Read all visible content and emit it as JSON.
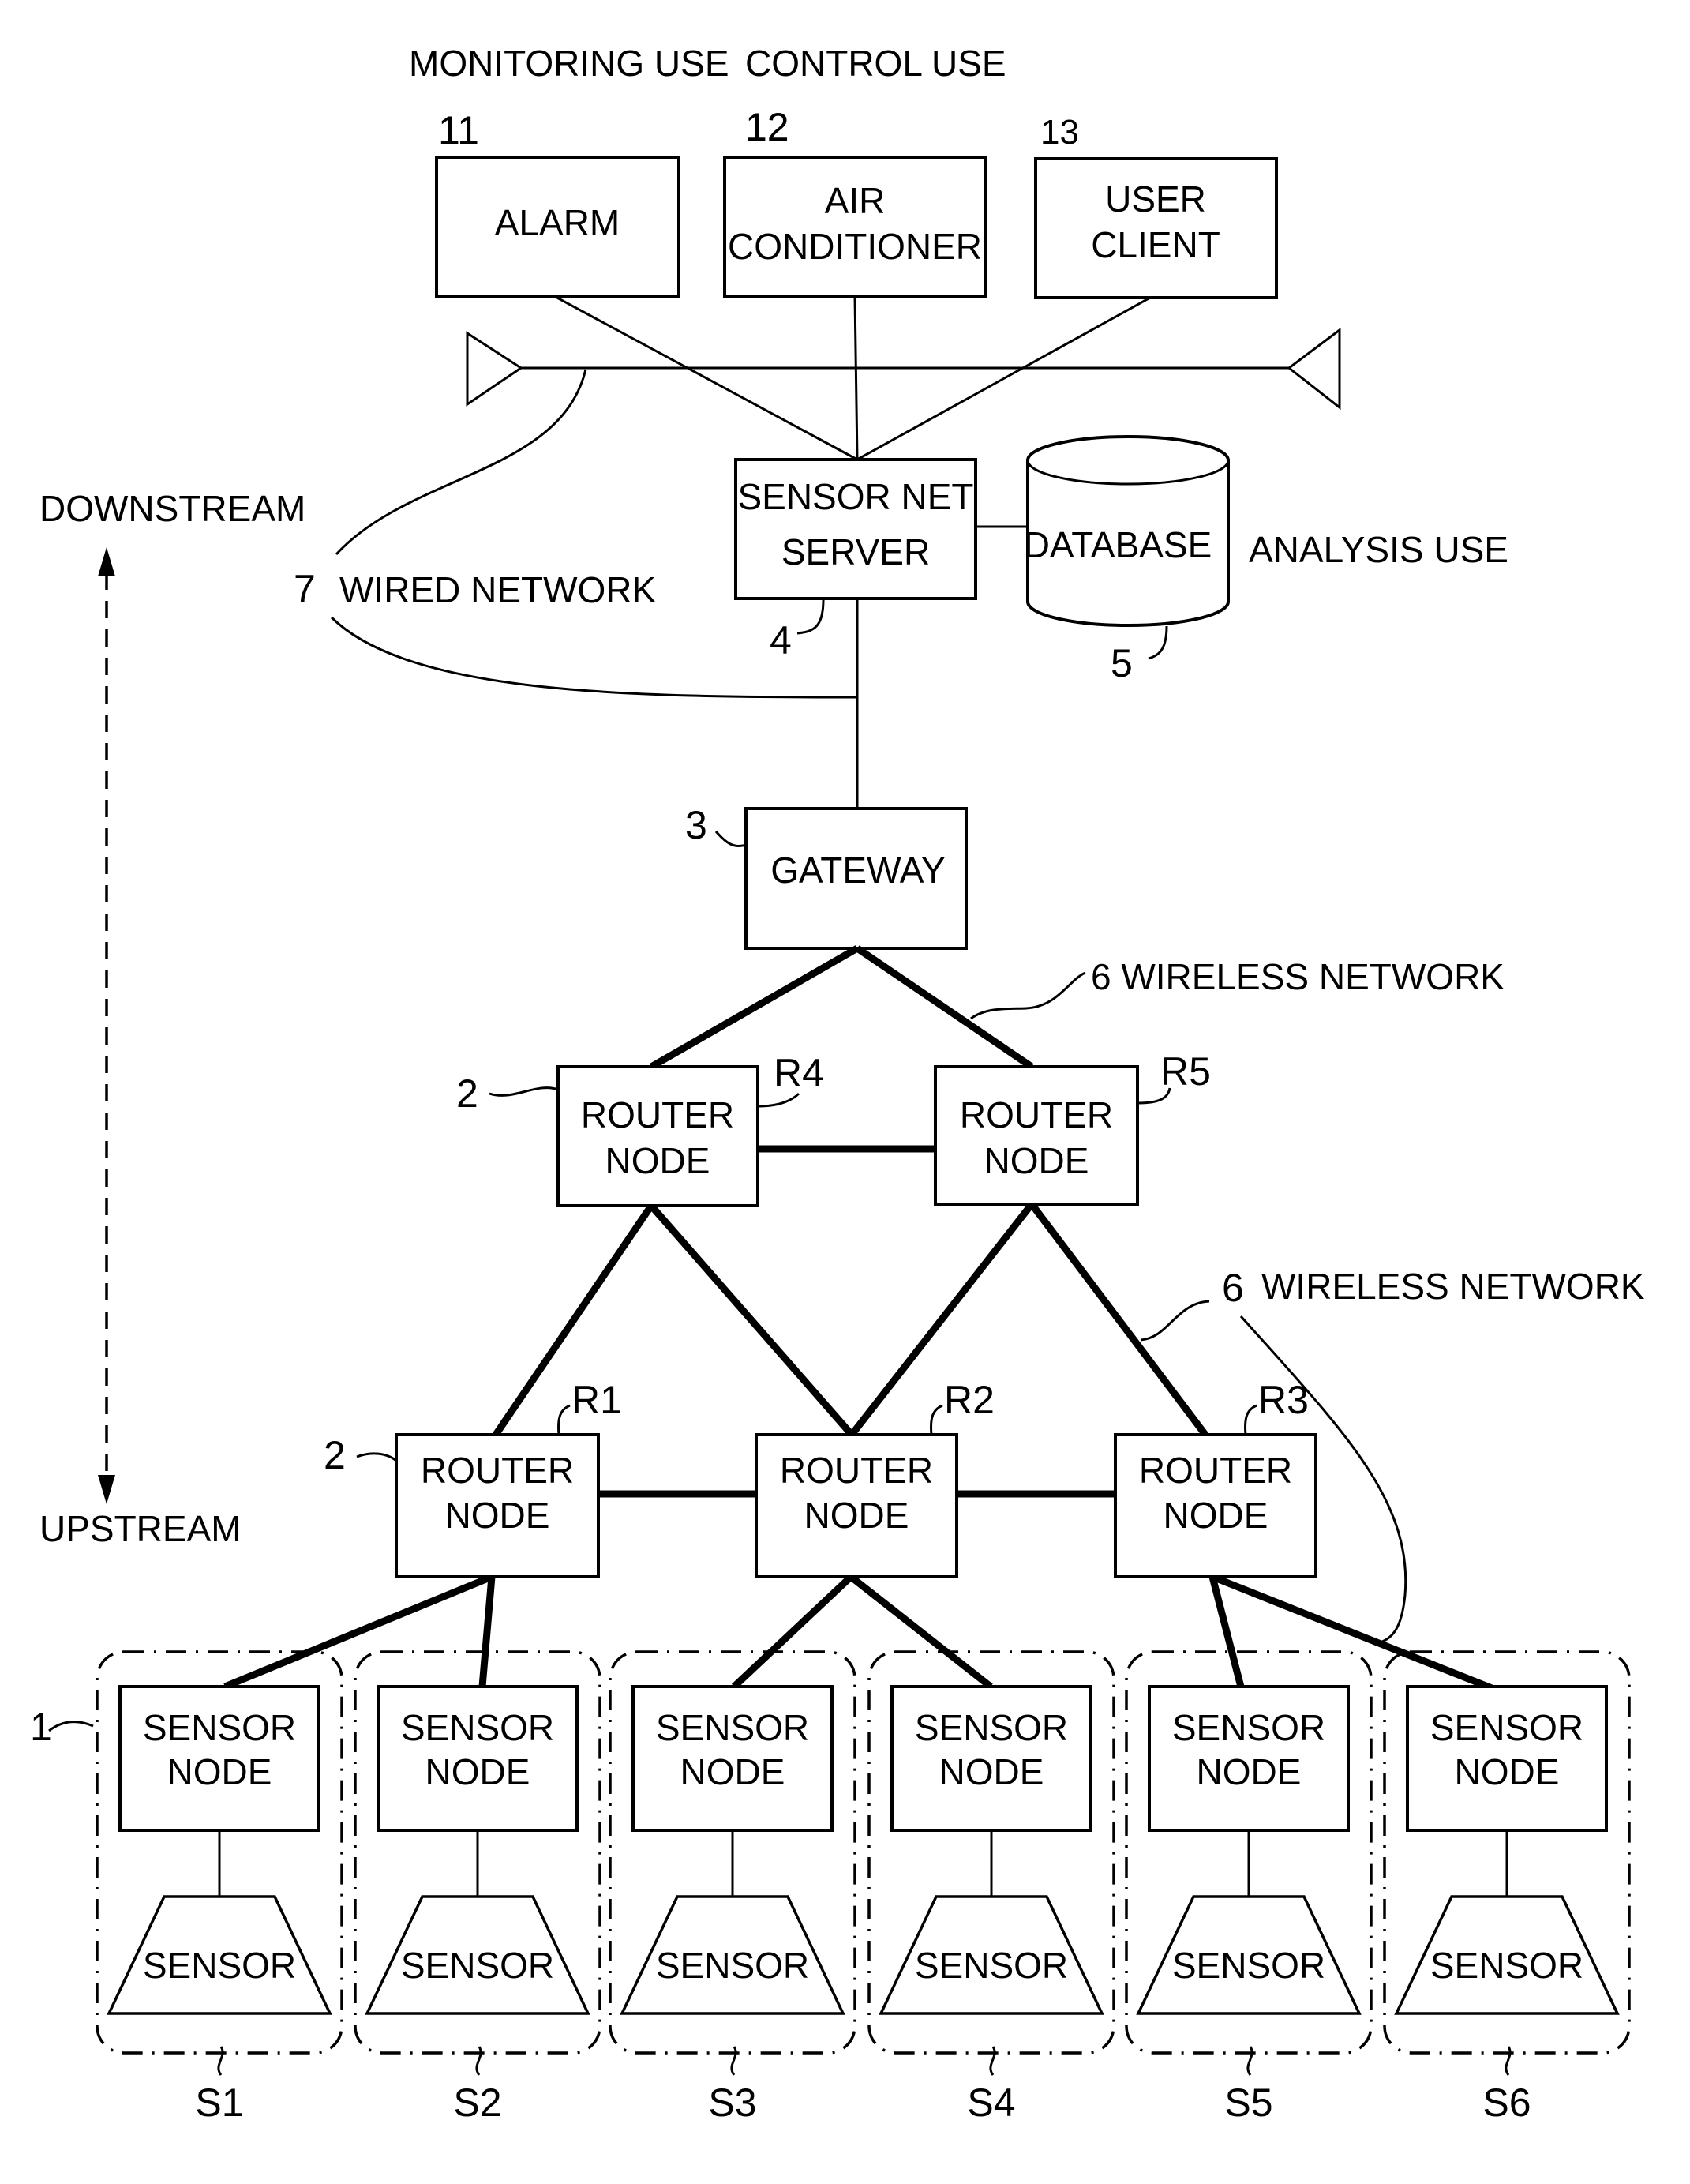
{
  "figure": {
    "headings": {
      "monitoring_use": "MONITORING USE",
      "control_use": "CONTROL USE",
      "analysis_use": "ANALYSIS USE"
    },
    "direction": {
      "downstream": "DOWNSTREAM",
      "upstream": "UPSTREAM"
    },
    "clients": [
      {
        "ref": "11",
        "lines": [
          "ALARM"
        ]
      },
      {
        "ref": "12",
        "lines": [
          "AIR",
          "CONDITIONER"
        ]
      },
      {
        "ref": "13",
        "lines": [
          "USER",
          "CLIENT"
        ]
      }
    ],
    "server": {
      "ref": "4",
      "lines": [
        "SENSOR NET",
        "SERVER"
      ]
    },
    "database": {
      "ref": "5",
      "label": "DATABASE"
    },
    "wired_network": {
      "ref": "7",
      "label": "WIRED NETWORK"
    },
    "gateway": {
      "ref": "3",
      "label": "GATEWAY"
    },
    "wireless_network_upper": {
      "label": "6 WIRELESS NETWORK"
    },
    "wireless_network_lower": {
      "ref": "6",
      "label": "WIRELESS NETWORK"
    },
    "router_ref": "2",
    "router_label": [
      "ROUTER",
      "NODE"
    ],
    "routers": [
      {
        "id": "R4"
      },
      {
        "id": "R5"
      },
      {
        "id": "R1"
      },
      {
        "id": "R2"
      },
      {
        "id": "R3"
      }
    ],
    "sensor_group_ref": "1",
    "sensor_node_label": [
      "SENSOR",
      "NODE"
    ],
    "sensor_label": "SENSOR",
    "sensor_groups": [
      {
        "id": "S1"
      },
      {
        "id": "S2"
      },
      {
        "id": "S3"
      },
      {
        "id": "S4"
      },
      {
        "id": "S5"
      },
      {
        "id": "S6"
      }
    ]
  }
}
